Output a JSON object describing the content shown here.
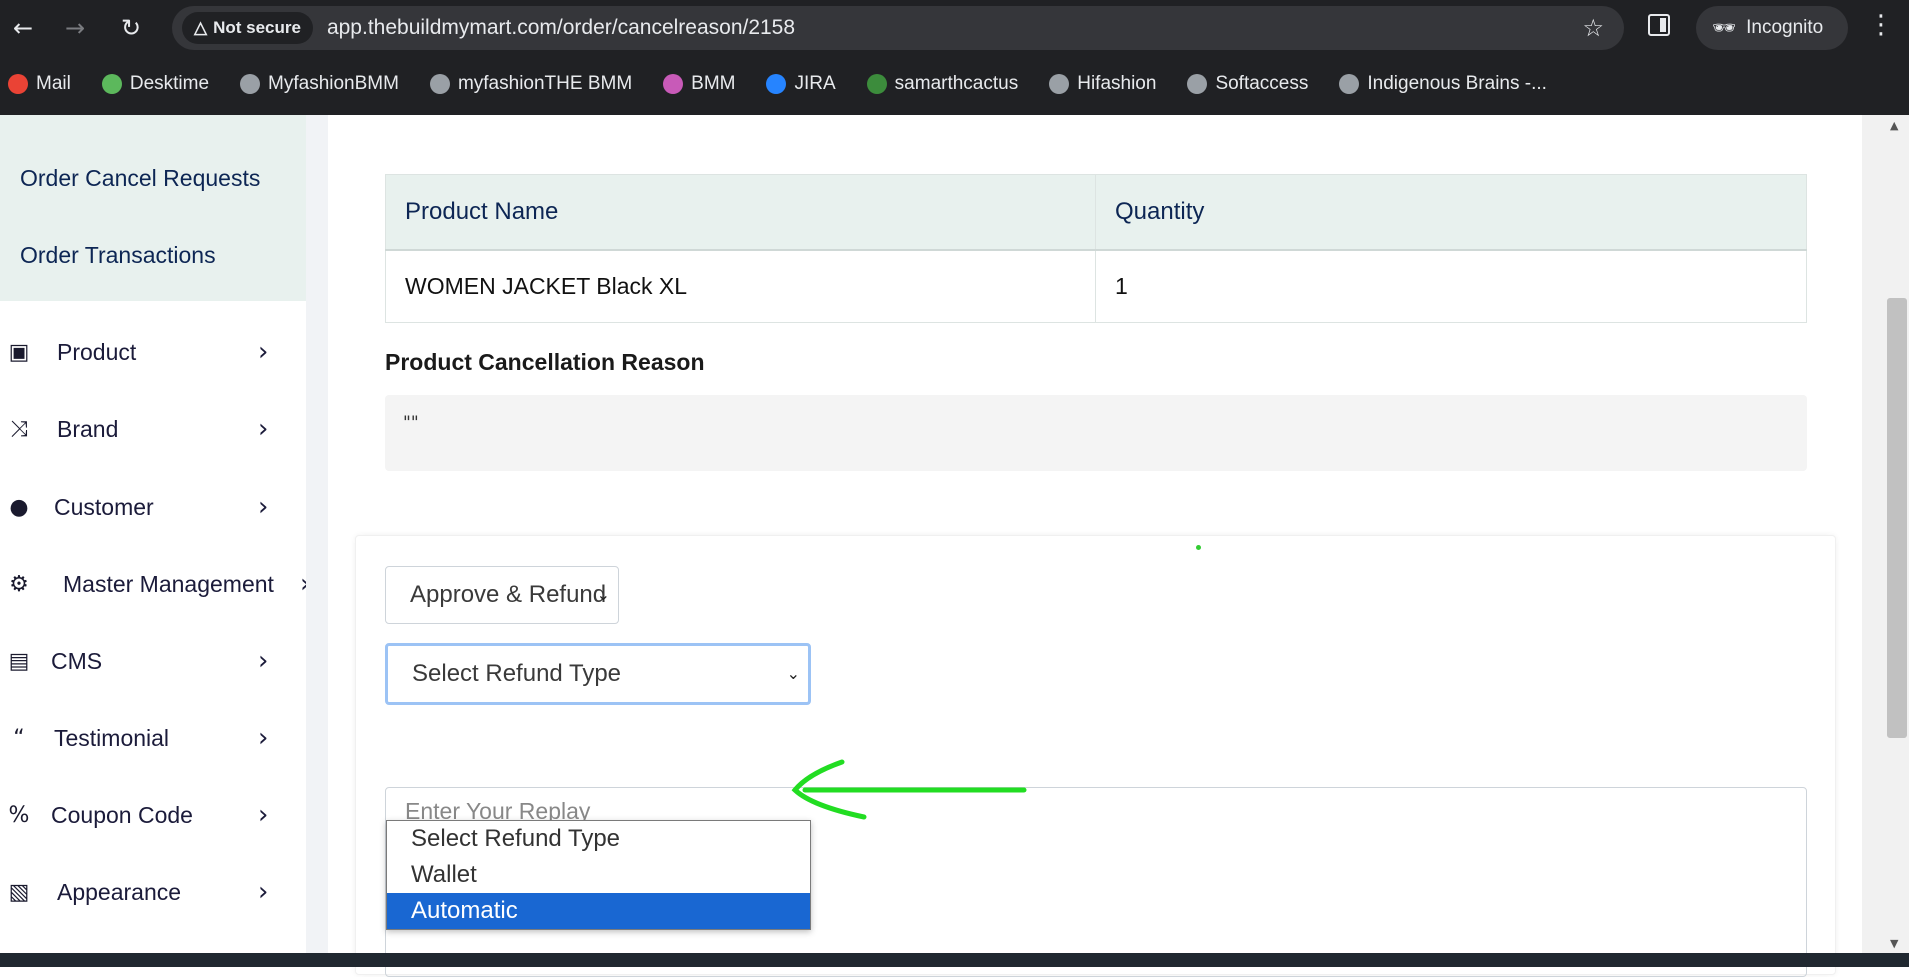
{
  "browser": {
    "security_label": "Not secure",
    "url": "app.thebuildmymart.com/order/cancelreason/2158",
    "profile_label": "Incognito",
    "bookmarks": [
      {
        "label": "Mail",
        "color": "#ea4335"
      },
      {
        "label": "Desktime",
        "color": "#5cb85c"
      },
      {
        "label": "MyfashionBMM",
        "color": "#9aa0a6"
      },
      {
        "label": "myfashionTHE BMM",
        "color": "#9aa0a6"
      },
      {
        "label": "BMM",
        "color": "#c85ab8"
      },
      {
        "label": "JIRA",
        "color": "#2684ff"
      },
      {
        "label": "samarthcactus",
        "color": "#3c8c3c"
      },
      {
        "label": "Hifashion",
        "color": "#9aa0a6"
      },
      {
        "label": "Softaccess",
        "color": "#9aa0a6"
      },
      {
        "label": "Indigenous Brains -...",
        "color": "#9aa0a6"
      }
    ]
  },
  "sidebar": {
    "sub_items": [
      "Order Cancel Requests",
      "Order Transactions"
    ],
    "menu": [
      {
        "label": "Product",
        "icon": "archive-icon"
      },
      {
        "label": "Brand",
        "icon": "shuffle-icon"
      },
      {
        "label": "Customer",
        "icon": "user-icon"
      },
      {
        "label": "Master Management",
        "icon": "user-gear-icon"
      },
      {
        "label": "CMS",
        "icon": "file-icon"
      },
      {
        "label": "Testimonial",
        "icon": "quote-icon"
      },
      {
        "label": "Coupon Code",
        "icon": "percent-icon"
      },
      {
        "label": "Appearance",
        "icon": "image-icon"
      }
    ]
  },
  "table": {
    "headers": [
      "Product Name",
      "Quantity"
    ],
    "rows": [
      [
        "WOMEN JACKET Black XL",
        "1"
      ]
    ]
  },
  "reason": {
    "title": "Product Cancellation Reason",
    "value": "\"\""
  },
  "form": {
    "status_value": "Approve & Refund",
    "refund_value": "Select Refund Type",
    "refund_options": [
      "Select Refund Type",
      "Wallet",
      "Automatic"
    ],
    "refund_highlighted": "Automatic",
    "reply_placeholder": "Enter Your Replay"
  },
  "colors": {
    "accent_green": "#22dd22",
    "sidebar_bg": "#e8f1ee",
    "select_highlight": "#1967d2"
  }
}
